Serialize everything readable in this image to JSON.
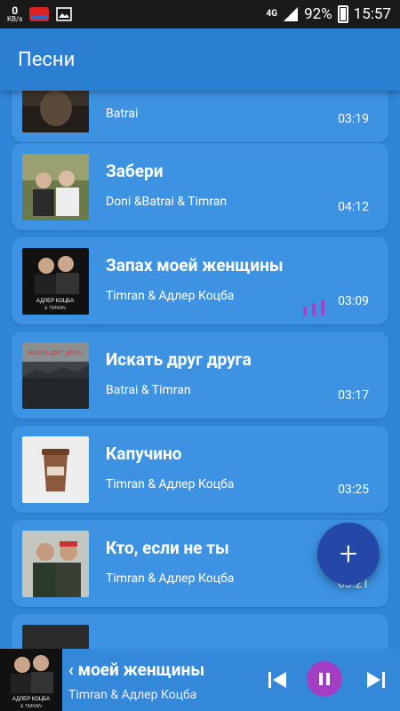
{
  "status": {
    "net_speed": "0",
    "net_unit": "KB/s",
    "lte": "4G",
    "battery": "92%",
    "time": "15:57"
  },
  "appbar": {
    "title": "Песни"
  },
  "songs": [
    {
      "title": "",
      "artist": "Batrai",
      "duration": "03:19"
    },
    {
      "title": "Забери",
      "artist": "Doni &Batrai & Timran",
      "duration": "04:12"
    },
    {
      "title": "Запах моей женщины",
      "artist": "Timran & Адлер Коцба",
      "duration": "03:09",
      "playing": true
    },
    {
      "title": "Искать друг друга",
      "artist": "Batrai & Timran",
      "duration": "03:17"
    },
    {
      "title": "Капучино",
      "artist": "Timran & Адлер Коцба",
      "duration": "03:25"
    },
    {
      "title": "Кто, если не ты",
      "artist": "Timran & Адлер Коцба",
      "duration": "03:21"
    }
  ],
  "fab": {
    "label": "+"
  },
  "player": {
    "title": "‹ моей женщины",
    "artist": "Timran & Адлер Коцба"
  },
  "colors": {
    "background": "#2f86d8",
    "card": "#3d92e2",
    "fab": "#2447a8",
    "accent": "#a33ec4"
  }
}
